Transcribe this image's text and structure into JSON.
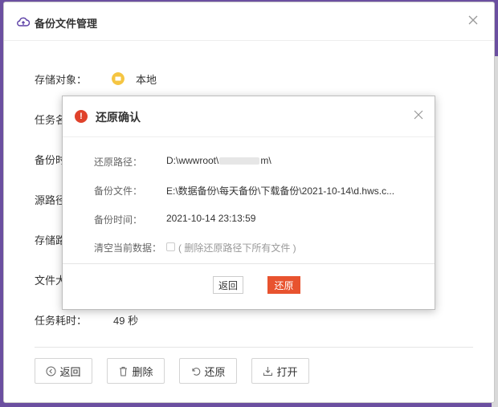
{
  "main_dialog": {
    "title": "备份文件管理",
    "fields": {
      "storage_label": "存储对象：",
      "storage_value": "本地",
      "task_name_label": "任务名",
      "backup_time_label": "备份时",
      "source_path_label": "源路径",
      "storage_path_label": "存储路",
      "file_size_label": "文件大",
      "duration_label": "任务耗时：",
      "duration_value": "49 秒"
    },
    "actions": {
      "back": "返回",
      "delete": "删除",
      "restore": "还原",
      "open": "打开"
    }
  },
  "confirm_dialog": {
    "title": "还原确认",
    "restore_path_label": "还原路径：",
    "restore_path_prefix": "D:\\wwwroot\\",
    "restore_path_suffix": "m\\",
    "backup_file_label": "备份文件：",
    "backup_file_value": "E:\\数据备份\\每天备份\\下载备份\\2021-10-14\\d.hws.c...",
    "backup_time_label": "备份时间：",
    "backup_time_value": "2021-10-14 23:13:59",
    "clear_label": "清空当前数据：",
    "clear_hint": "( 删除还原路径下所有文件 )",
    "back_button": "返回",
    "restore_button": "还原"
  },
  "colors": {
    "accent_red": "#e8532f",
    "warning_red": "#e0422b",
    "folder_yellow": "#f5c542",
    "header_purple": "#6b4fa0"
  }
}
